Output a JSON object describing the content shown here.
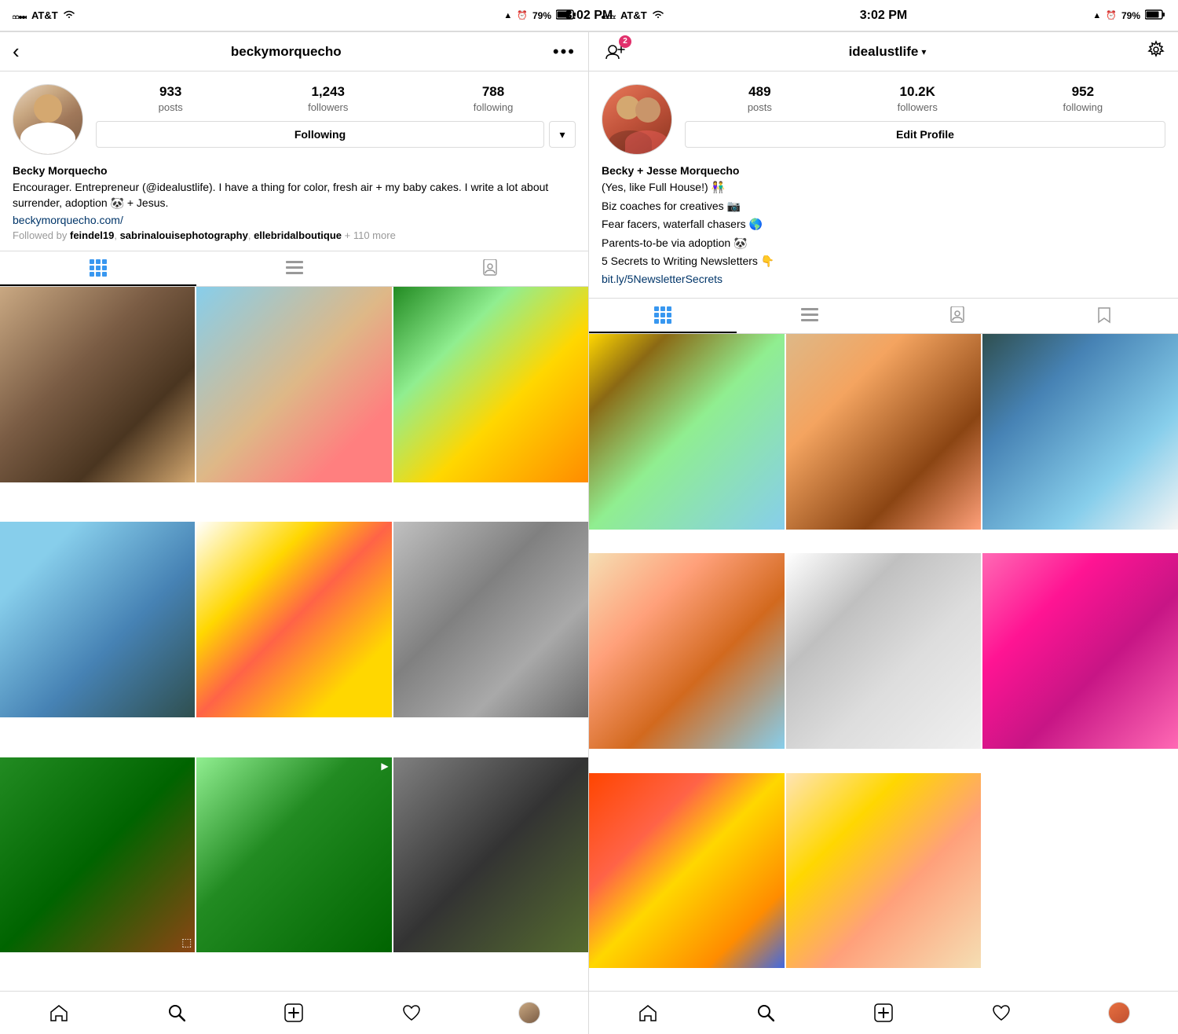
{
  "statusBar": {
    "carrier": "AT&T",
    "time": "3:02 PM",
    "battery": "79%"
  },
  "leftPanel": {
    "nav": {
      "backLabel": "‹",
      "title": "beckymorquecho",
      "menuLabel": "•••"
    },
    "profile": {
      "stats": {
        "posts": {
          "value": "933",
          "label": "posts"
        },
        "followers": {
          "value": "1,243",
          "label": "followers"
        },
        "following": {
          "value": "788",
          "label": "following"
        }
      },
      "followButton": "Following",
      "dropdownArrow": "▾",
      "name": "Becky Morquecho",
      "bio": "Encourager. Entrepreneur (@idealustlife). I have a thing for color, fresh air + my baby cakes. I write a lot about surrender, adoption 🐼 + Jesus.",
      "link": "beckymorquecho.com/",
      "followedBy": "Followed by feindel19, sabrinalouisephotography, ellebridalboutique + 110 more"
    },
    "tabs": {
      "grid": "⊞",
      "list": "≡",
      "tagged": "👤"
    },
    "bottomNav": {
      "home": "⌂",
      "search": "🔍",
      "add": "⊕",
      "heart": "♡",
      "profile": "👤"
    }
  },
  "rightPanel": {
    "nav": {
      "addFriend": "+👤",
      "badge": "2",
      "title": "idealustlife",
      "titleArrow": "∨",
      "settings": "⚙"
    },
    "profile": {
      "stats": {
        "posts": {
          "value": "489",
          "label": "posts"
        },
        "followers": {
          "value": "10.2K",
          "label": "followers"
        },
        "following": {
          "value": "952",
          "label": "following"
        }
      },
      "editButton": "Edit Profile",
      "name": "Becky + Jesse Morquecho",
      "bio1": "(Yes, like Full House!) 👫",
      "bio2": "Biz coaches for creatives 📷",
      "bio3": "Fear facers, waterfall chasers 🌎",
      "bio4": "Parents-to-be via adoption 🐼",
      "bio5": "5 Secrets to Writing Newsletters 👇",
      "link": "bit.ly/5NewsletterSecrets"
    },
    "tabs": {
      "grid": "⊞",
      "list": "≡",
      "tagged": "👤",
      "bookmark": "🔖"
    },
    "bottomNav": {
      "home": "⌂",
      "search": "🔍",
      "add": "⊕",
      "heart": "♡",
      "profile": "👤"
    }
  }
}
